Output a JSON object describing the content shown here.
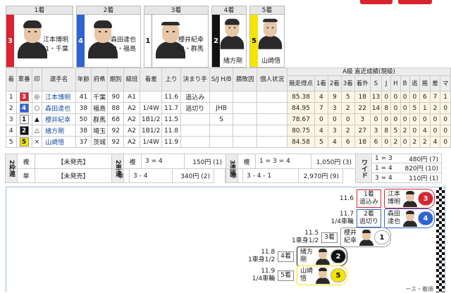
{
  "colors": {
    "car1": "#ffffff",
    "car2": "#111111",
    "car3": "#d9232e",
    "car4": "#2f63d6",
    "car5": "#f5e400"
  },
  "podium": [
    {
      "rank": "1着",
      "car": "3",
      "name": "江本博明",
      "info": "A1・千葉",
      "color": "#d9232e",
      "text": "#ffffff"
    },
    {
      "rank": "2着",
      "car": "4",
      "name": "森田達也",
      "info": "A2・福島",
      "color": "#2f63d6",
      "text": "#ffffff"
    },
    {
      "rank": "3着",
      "car": "1",
      "name": "櫻井紀幸",
      "info": "A2・群馬",
      "color": "#ffffff",
      "text": "#111111"
    },
    {
      "rank": "4着",
      "car": "2",
      "name": "緒方剛",
      "info": "",
      "color": "#111111",
      "text": "#ffffff"
    },
    {
      "rank": "5着",
      "car": "5",
      "name": "山崎悟",
      "info": "",
      "color": "#f5e400",
      "text": "#111111"
    }
  ],
  "table": {
    "headers": [
      "着",
      "車番",
      "印",
      "選手名",
      "年齢",
      "府県",
      "期別",
      "級班",
      "着差",
      "上り",
      "決まり手",
      "S/J H/B",
      "勝敗因",
      "個人状況",
      "競走得点",
      "1着",
      "2着",
      "3着",
      "着外",
      "S",
      "J",
      "H",
      "B",
      "逃",
      "捲",
      "差",
      "マ"
    ],
    "recent_header": "A級 直近成績(現級)",
    "rows": [
      [
        "1",
        "3",
        "◎",
        "江本博明",
        "41",
        "千葉",
        "90",
        "A1",
        "",
        "11.6",
        "追込み",
        "",
        "",
        "",
        "85.38",
        "4",
        "9",
        "5",
        "18",
        "13",
        "0",
        "0",
        "0",
        "0",
        "6",
        "7",
        "1"
      ],
      [
        "2",
        "4",
        "○",
        "森田達也",
        "38",
        "福島",
        "88",
        "A2",
        "1/4W",
        "11.7",
        "逃切り",
        "JHB",
        "",
        "",
        "84.95",
        "7",
        "3",
        "2",
        "22",
        "14",
        "8",
        "0",
        "0",
        "5",
        "1",
        "2",
        "0"
      ],
      [
        "3",
        "1",
        "▲",
        "櫻井紀幸",
        "50",
        "群馬",
        "68",
        "A2",
        "1B1/2",
        "11.5",
        "",
        "S",
        "",
        "",
        "78.67",
        "0",
        "0",
        "0",
        "3",
        "0",
        "0",
        "0",
        "0",
        "0",
        "0",
        "0",
        "0"
      ],
      [
        "4",
        "2",
        "△",
        "緒方剛",
        "38",
        "埼玉",
        "92",
        "A2",
        "1B1/2",
        "11.8",
        "",
        "",
        "",
        "",
        "80.75",
        "4",
        "3",
        "2",
        "27",
        "3",
        "8",
        "5",
        "2",
        "0",
        "4",
        "0",
        "0"
      ],
      [
        "5",
        "5",
        "×",
        "山崎悟",
        "37",
        "茨城",
        "92",
        "A2",
        "1/4W",
        "11.9",
        "",
        "",
        "",
        "",
        "84.58",
        "5",
        "4",
        "6",
        "18",
        "6",
        "0",
        "2",
        "0",
        "2",
        "2",
        "4",
        "0"
      ]
    ]
  },
  "odds": {
    "wakuren_label": "2枠連",
    "wakuren": [
      {
        "type": "複",
        "value": "【未発売】"
      },
      {
        "type": "単",
        "value": "【未発売】"
      }
    ],
    "shaken_label": "2車連",
    "shaken": [
      {
        "type": "複",
        "combo": "3 = 4",
        "value": "150円 (1)"
      },
      {
        "type": "単",
        "combo": "3 - 4",
        "value": "340円 (2)"
      }
    ],
    "sanrentan_label": "3連勝",
    "sanren": [
      {
        "type": "複",
        "combo": "1 = 3 = 4",
        "value": "1,050円 (3)"
      },
      {
        "type": "単",
        "combo": "3 - 4 - 1",
        "value": "2,970円 (9)"
      }
    ],
    "wide_label": "ワイド",
    "wide": [
      {
        "combo": "1 = 3",
        "value": "480円 (7)"
      },
      {
        "combo": "1 = 4",
        "value": "820円 (10)"
      },
      {
        "combo": "3 = 4",
        "value": "110円 (1)"
      }
    ]
  },
  "diagram": [
    {
      "time": "11.6",
      "margin": "",
      "rank": "1着",
      "kimarite": "追込み",
      "name1": "江本",
      "name2": "博明",
      "car": "3",
      "color": "#d9232e",
      "text": "#ffffff"
    },
    {
      "time": "11.7",
      "margin": "1/4車輪",
      "rank": "2着",
      "kimarite": "逃切り",
      "name1": "森田",
      "name2": "達也",
      "car": "4",
      "color": "#2f63d6",
      "text": "#ffffff"
    },
    {
      "time": "11.5",
      "margin": "1車身1/2",
      "rank": "3着",
      "kimarite": "",
      "name1": "櫻井",
      "name2": "紀幸",
      "car": "1",
      "color": "#ffffff",
      "text": "#111111"
    },
    {
      "time": "11.8",
      "margin": "1車身1/2",
      "rank": "4着",
      "kimarite": "",
      "name1": "緒方",
      "name2": "剛",
      "car": "2",
      "color": "#111111",
      "text": "#ffffff"
    },
    {
      "time": "11.9",
      "margin": "1/4車輪",
      "rank": "5着",
      "kimarite": "",
      "name1": "山崎",
      "name2": "悟",
      "car": "5",
      "color": "#f5e400",
      "text": "#111111"
    }
  ],
  "footer_partial": "ース・着順"
}
